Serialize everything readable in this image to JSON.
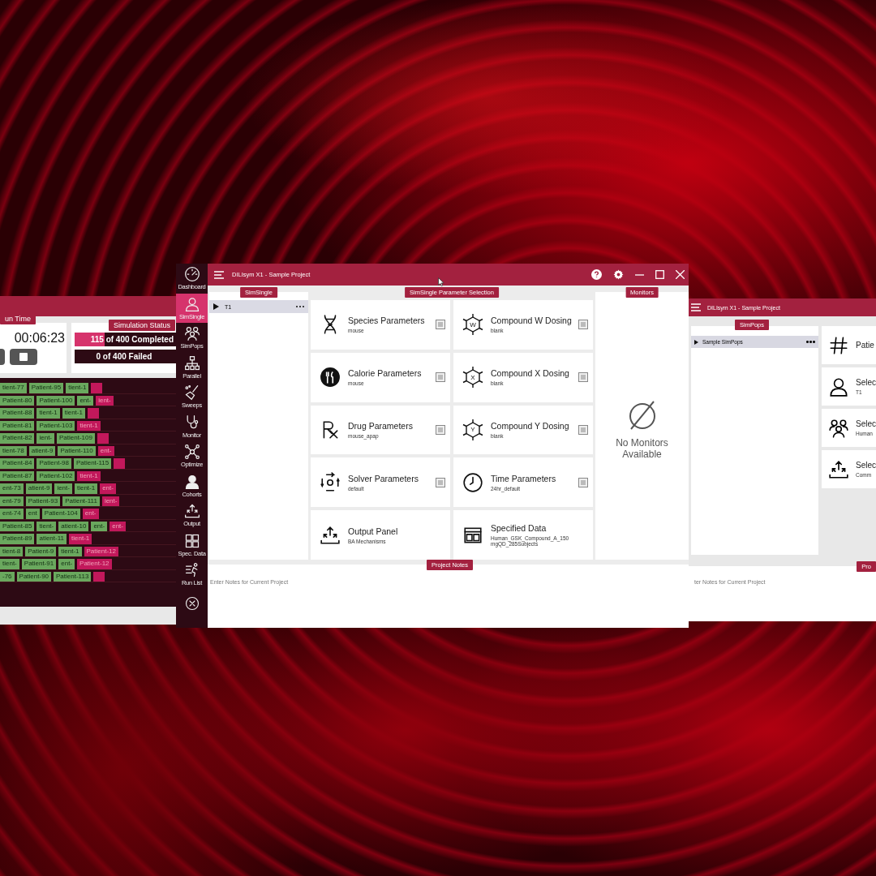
{
  "left_window": {
    "run_time": {
      "tag": "un Time",
      "value": "00:06:23"
    },
    "status": {
      "tag": "Simulation Status",
      "completed": {
        "text": "115 of 400 Completed",
        "level": 0.29
      },
      "failed": {
        "text": "0 of 400 Failed"
      }
    },
    "patients": [
      [
        {
          "text": "tient-77",
          "running": false
        },
        {
          "text": "Patient-95",
          "running": false
        },
        {
          "text": "tient-1",
          "running": false
        },
        {
          "running": true
        }
      ],
      [
        {
          "text": "Patient-80",
          "running": false
        },
        {
          "text": "Patient-100",
          "running": false
        },
        {
          "text": "ent-",
          "running": false
        },
        {
          "text": "ient-",
          "running": true
        }
      ],
      [
        {
          "text": "Patient-88",
          "running": false
        },
        {
          "text": "tient-1",
          "running": false
        },
        {
          "text": "tient-1",
          "running": false
        },
        {
          "running": true
        }
      ],
      [
        {
          "text": "Patient-81",
          "running": false
        },
        {
          "text": "Patient-103",
          "running": false
        },
        {
          "text": "tient-1",
          "running": true
        }
      ],
      [
        {
          "text": "Patient-82",
          "running": false
        },
        {
          "text": "ient-",
          "running": false
        },
        {
          "text": "Patient-109",
          "running": false
        },
        {
          "running": true
        }
      ],
      [
        {
          "text": "tient-78",
          "running": false
        },
        {
          "text": "atient-9",
          "running": false
        },
        {
          "text": "Patient-110",
          "running": false
        },
        {
          "text": "ent-",
          "running": true
        }
      ],
      [
        {
          "text": "Patient-84",
          "running": false
        },
        {
          "text": "Patient-98",
          "running": false
        },
        {
          "text": "Patient-115",
          "running": false
        },
        {
          "running": true
        }
      ],
      [
        {
          "text": "Patient-87",
          "running": false
        },
        {
          "text": "Patient-102",
          "running": false
        },
        {
          "text": "tient-1",
          "running": true
        }
      ],
      [
        {
          "text": "ent-73",
          "running": false
        },
        {
          "text": "atient-9",
          "running": false
        },
        {
          "text": "ient-",
          "running": false
        },
        {
          "text": "tient-1",
          "running": false
        },
        {
          "text": "ent-",
          "running": true
        }
      ],
      [
        {
          "text": "ent-79",
          "running": false
        },
        {
          "text": "Patient-93",
          "running": false
        },
        {
          "text": "Patient-111",
          "running": false
        },
        {
          "text": "ient-",
          "running": true
        }
      ],
      [
        {
          "text": "ent-74",
          "running": false
        },
        {
          "text": "ent",
          "running": false
        },
        {
          "text": "Patient-104",
          "running": false
        },
        {
          "text": "ent-",
          "running": true
        }
      ],
      [
        {
          "text": "Patient-85",
          "running": false
        },
        {
          "text": "tient-",
          "running": false
        },
        {
          "text": "atient-10",
          "running": false
        },
        {
          "text": "ent-",
          "running": false
        },
        {
          "text": "ent-",
          "running": true
        }
      ],
      [
        {
          "text": "Patient-89",
          "running": false
        },
        {
          "text": "atient-11",
          "running": false
        },
        {
          "text": "tient-1",
          "running": true
        }
      ],
      [
        {
          "text": "tient-8",
          "running": false
        },
        {
          "text": "Patient-9",
          "running": false
        },
        {
          "text": "tient-1",
          "running": false
        },
        {
          "text": "Patient-12",
          "running": true
        }
      ],
      [
        {
          "text": "tient-",
          "running": false
        },
        {
          "text": "Patient-91",
          "running": false
        },
        {
          "text": "ent-",
          "running": false
        },
        {
          "text": "Patient-12",
          "running": true
        }
      ],
      [
        {
          "text": "-76",
          "running": false
        },
        {
          "text": "Patient-90",
          "running": false
        },
        {
          "text": "Patient-113",
          "running": false
        },
        {
          "running": true
        }
      ]
    ]
  },
  "center_window": {
    "title": "DILIsym X1 - Sample Project",
    "nav": [
      {
        "label": "Dashboard",
        "selected": false
      },
      {
        "label": "SimSingle",
        "selected": true
      },
      {
        "label": "SimPops",
        "selected": false
      },
      {
        "label": "Parallel",
        "selected": false
      },
      {
        "label": "Sweeps",
        "selected": false
      },
      {
        "label": "Monitor",
        "selected": false
      },
      {
        "label": "Optimize",
        "selected": false
      },
      {
        "label": "Cohorts",
        "selected": false
      },
      {
        "label": "Output",
        "selected": false
      },
      {
        "label": "Spec. Data",
        "selected": false
      },
      {
        "label": "Run List",
        "selected": false
      }
    ],
    "left_panel": {
      "tag": "SimSingle",
      "items": [
        {
          "label": "T1",
          "selected": true
        }
      ]
    },
    "params": {
      "tag": "SimSingle Parameter Selection",
      "cards": [
        {
          "title": "Species Parameters",
          "value": "mouse",
          "editable": true
        },
        {
          "title": "Compound W Dosing",
          "value": "blank",
          "editable": true,
          "letter": "W"
        },
        {
          "title": "Calorie Parameters",
          "value": "mouse",
          "editable": true
        },
        {
          "title": "Compound X Dosing",
          "value": "blank",
          "editable": true,
          "letter": "X"
        },
        {
          "title": "Drug Parameters",
          "value": "mouse_apap",
          "editable": true
        },
        {
          "title": "Compound Y Dosing",
          "value": "blank",
          "editable": true,
          "letter": "Y"
        },
        {
          "title": "Solver Parameters",
          "value": "default",
          "editable": true
        },
        {
          "title": "Time Parameters",
          "value": "24hr_default",
          "editable": true
        },
        {
          "title": "Output Panel",
          "value": "BA Mechanisms",
          "editable": false
        },
        {
          "title": "Specified Data",
          "value": "Human_GSK_Compound_A_150 mgQD_285Subjects",
          "editable": false
        }
      ]
    },
    "monitors": {
      "tag": "Monitors",
      "empty_text": "No Monitors Available"
    },
    "notes": {
      "placeholder": "Enter Notes for Current Project",
      "tag": "Project Notes"
    }
  },
  "right_window": {
    "title": "DILIsym X1 - Sample Project",
    "tag": "SimPops",
    "items": [
      {
        "label": "Sample SimPops",
        "selected": true
      }
    ],
    "cards": [
      {
        "title": "Patie"
      },
      {
        "title": "Selec",
        "value": "T1"
      },
      {
        "title": "Selec",
        "value": "Human"
      },
      {
        "title": "Selec",
        "value": "Comm"
      }
    ],
    "notes": {
      "placeholder": "ter Notes for Current Project",
      "tag": "Pro"
    }
  }
}
